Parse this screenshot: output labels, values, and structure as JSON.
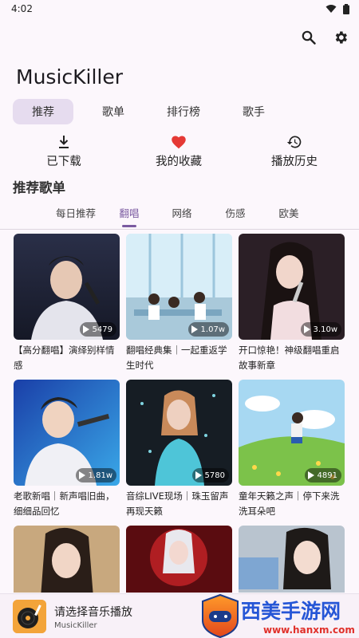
{
  "status": {
    "time": "4:02"
  },
  "app": {
    "title": "MusicKiller"
  },
  "tabs": [
    {
      "label": "推荐",
      "active": true
    },
    {
      "label": "歌单",
      "active": false
    },
    {
      "label": "排行榜",
      "active": false
    },
    {
      "label": "歌手",
      "active": false
    }
  ],
  "quick_actions": [
    {
      "label": "已下载",
      "icon": "download-icon"
    },
    {
      "label": "我的收藏",
      "icon": "heart-icon"
    },
    {
      "label": "播放历史",
      "icon": "history-icon"
    }
  ],
  "section": {
    "title": "推荐歌单"
  },
  "subtabs": [
    {
      "label": "每日推荐",
      "active": false
    },
    {
      "label": "翻唱",
      "active": true
    },
    {
      "label": "网络",
      "active": false
    },
    {
      "label": "伤感",
      "active": false
    },
    {
      "label": "欧美",
      "active": false
    }
  ],
  "playlists": [
    {
      "title": "【高分翻唱】演绎别样情感",
      "plays": "5479"
    },
    {
      "title": "翻唱经典集｜一起重返学生时代",
      "plays": "1.07w"
    },
    {
      "title": "开口惊艳！神级翻唱重启故事新章",
      "plays": "3.10w"
    },
    {
      "title": "老歌新唱｜新声唱旧曲，细细品回忆",
      "plays": "1.81w"
    },
    {
      "title": "音综LIVE现场｜珠玉留声再现天籁",
      "plays": "5780"
    },
    {
      "title": "童年天籁之声｜停下来洗洗耳朵吧",
      "plays": "4891"
    }
  ],
  "player": {
    "title": "请选择音乐播放",
    "subtitle": "MusicKiller"
  },
  "watermark": {
    "text": "西美手游网",
    "url": "www.hanxm.com"
  },
  "colors": {
    "accent": "#7a5aa0",
    "heart": "#e53935",
    "tab_active_bg": "#e6dcef"
  }
}
